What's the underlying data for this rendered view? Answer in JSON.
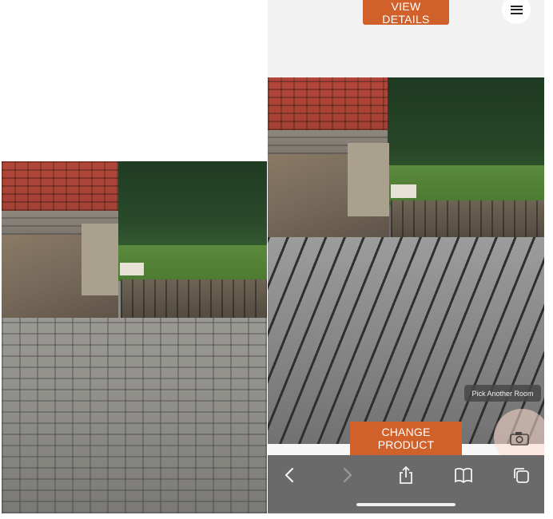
{
  "left_photo": {
    "icon": "paved-courtyard-photo"
  },
  "phone": {
    "header": {
      "view_details_label": "VIEW DETAILS",
      "menu_icon": "hamburger-menu-icon"
    },
    "ar_view": {
      "pick_room_label": "Pick Another Room",
      "change_product_label": "CHANGE PRODUCT",
      "camera_icon": "camera-icon"
    },
    "browser_toolbar": {
      "back_icon": "chevron-left-icon",
      "forward_icon": "chevron-right-icon",
      "share_icon": "share-icon",
      "bookmarks_icon": "book-icon",
      "tabs_icon": "tabs-icon"
    }
  },
  "colors": {
    "accent": "#d0612b",
    "toolbar": "#6a6a6a",
    "header_bg": "#f2f2f2"
  }
}
